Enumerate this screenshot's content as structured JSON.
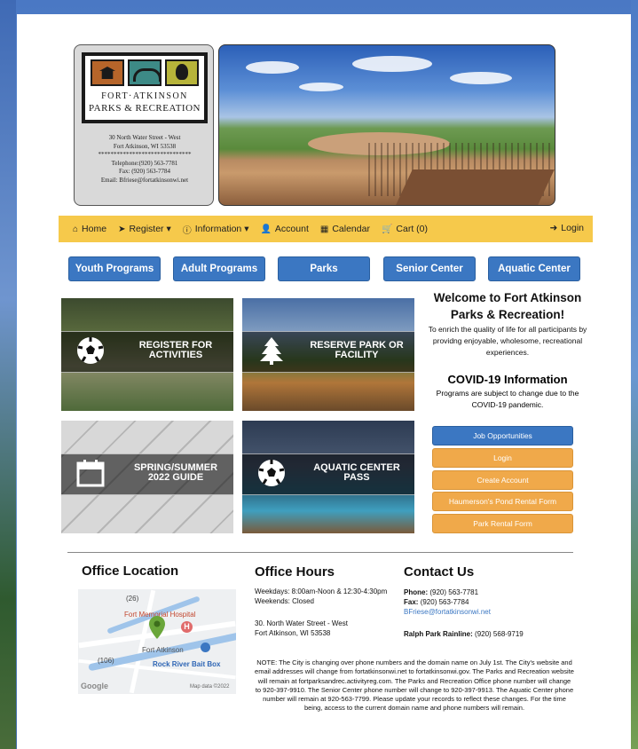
{
  "logo": {
    "name_line1": "FORT·ATKINSON",
    "name_line2": "PARKS & RECREATION",
    "address1": "30 North Water Street - West",
    "address2": "Fort Atkinson, WI 53538",
    "stars": "******************************",
    "phone": "Telephone:(920) 563-7781",
    "fax": "Fax: (920) 563-7784",
    "email": "Email: Bfriese@fortatkinsonwi.net"
  },
  "nav": {
    "items": [
      {
        "icon": "home-icon",
        "glyph": "⌂",
        "label": "Home"
      },
      {
        "icon": "send-icon",
        "glyph": "➤",
        "label": "Register ▾"
      },
      {
        "icon": "info-icon",
        "glyph": "ⓘ",
        "label": "Information ▾"
      },
      {
        "icon": "user-icon",
        "glyph": "👤",
        "label": "Account"
      },
      {
        "icon": "calendar-icon",
        "glyph": "▦",
        "label": "Calendar"
      },
      {
        "icon": "cart-icon",
        "glyph": "🛒",
        "label": "Cart (0)"
      }
    ],
    "login": "Login"
  },
  "programs": [
    "Youth Programs",
    "Adult Programs",
    "Parks",
    "Senior Center",
    "Aquatic Center"
  ],
  "tiles": [
    {
      "label": "REGISTER FOR ACTIVITIES",
      "icon": "soccer-ball-icon"
    },
    {
      "label": "RESERVE PARK OR FACILITY",
      "icon": "tree-icon"
    },
    {
      "label": "SPRING/SUMMER 2022 GUIDE",
      "icon": "calendar-icon"
    },
    {
      "label": "AQUATIC CENTER PASS",
      "icon": "soccer-ball-icon"
    }
  ],
  "welcome": {
    "title1": "Welcome to Fort Atkinson",
    "title2": "Parks & Recreation!",
    "body": "To enrich the quality of life for all participants by providng enjoyable, wholesome, recreational experiences."
  },
  "covid": {
    "title": "COVID-19 Information",
    "body": "Programs are subject to change due to the COVID-19 pandemic."
  },
  "side_buttons": [
    {
      "label": "Job Opportunities",
      "style": "blue"
    },
    {
      "label": "Login",
      "style": "orange"
    },
    {
      "label": "Create Account",
      "style": "orange"
    },
    {
      "label": "Haumerson's Pond Rental Form",
      "style": "orange"
    },
    {
      "label": "Park Rental Form",
      "style": "orange"
    }
  ],
  "footer": {
    "office_location_title": "Office Location",
    "map": {
      "label1": "Fort Memorial Hospital",
      "label2": "Fort Atkinson",
      "label3": "Rock River Bait Box",
      "route1": "(26)",
      "route2": "(106)",
      "brand": "Google",
      "credit": "Map data ©2022"
    },
    "office_hours_title": "Office Hours",
    "hours_weekdays": "Weekdays: 8:00am-Noon & 12:30-4:30pm",
    "hours_weekends": "Weekends: Closed",
    "address1": "30. North Water Street - West",
    "address2": "Fort Atkinson, WI 53538",
    "contact_title": "Contact Us",
    "phone_label": "Phone:",
    "phone": "(920) 563-7781",
    "fax_label": "Fax:",
    "fax": "(920) 563-7784",
    "email": "BFriese@fortatkinsonwi.net",
    "rainline_label": "Ralph Park Rainline:",
    "rainline": "(920) 568-9719",
    "note": "NOTE: The City is changing over phone numbers and the domain name on July 1st. The City's website and email addresses will change from fortatkinsonwi.net to fortatkinsonwi.gov. The Parks and Recreation website will remain at fortparksandrec.activityreg.com. The Parks and Recreation Office phone number will change to 920-397-9910. The Senior Center phone number will change to 920-397-9913. The Aquatic Center phone number will remain at 920-563-7799. Please update your records to reflect these changes. For the time being, access to the current domain name and phone numbers will remain."
  },
  "colors": {
    "nav_bg": "#f6c94b",
    "primary_blue": "#3b77c2",
    "accent_orange": "#f0a94a"
  }
}
